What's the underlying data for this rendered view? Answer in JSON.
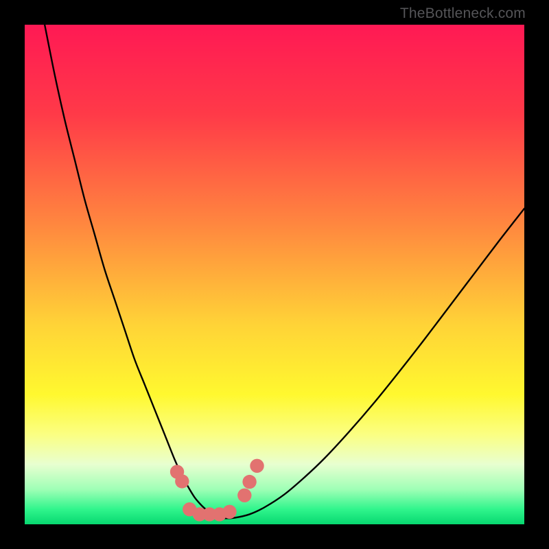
{
  "watermark": {
    "text": "TheBottleneck.com"
  },
  "chart_data": {
    "type": "line",
    "title": "",
    "xlabel": "",
    "ylabel": "",
    "xlim": [
      0,
      100
    ],
    "ylim": [
      0,
      100
    ],
    "gradient_stops": [
      {
        "offset": 0,
        "color": "#ff1954"
      },
      {
        "offset": 18,
        "color": "#ff3a48"
      },
      {
        "offset": 40,
        "color": "#ff873f"
      },
      {
        "offset": 60,
        "color": "#ffd337"
      },
      {
        "offset": 74,
        "color": "#fff82f"
      },
      {
        "offset": 82,
        "color": "#fbff82"
      },
      {
        "offset": 88,
        "color": "#e8ffd0"
      },
      {
        "offset": 93,
        "color": "#9fffb6"
      },
      {
        "offset": 97,
        "color": "#30f58c"
      },
      {
        "offset": 100,
        "color": "#07d870"
      }
    ],
    "series": [
      {
        "name": "bottleneck-curve",
        "x": [
          4,
          6,
          8,
          10,
          12,
          14,
          16,
          18,
          20,
          22,
          24,
          26,
          28,
          30,
          31,
          32,
          33,
          34,
          35,
          36,
          37,
          38,
          39,
          40,
          42,
          45,
          48,
          52,
          56,
          60,
          65,
          70,
          75,
          80,
          85,
          90,
          95,
          100
        ],
        "y": [
          100,
          90,
          81,
          73,
          65,
          58,
          51,
          45,
          39,
          33,
          28,
          23,
          18,
          13,
          10.8,
          8.8,
          7,
          5.4,
          4.2,
          3.2,
          2.4,
          1.8,
          1.4,
          1.2,
          1.3,
          2.0,
          3.4,
          6.0,
          9.4,
          13.2,
          18.6,
          24.4,
          30.6,
          37.0,
          43.6,
          50.2,
          56.8,
          63.2
        ]
      }
    ],
    "markers": {
      "name": "highlighted-points",
      "color": "#e27270",
      "radius_ratio": 0.014,
      "points": [
        {
          "x": 30.5,
          "y": 10.5
        },
        {
          "x": 31.5,
          "y": 8.6
        },
        {
          "x": 33.0,
          "y": 3.0
        },
        {
          "x": 35.0,
          "y": 2.0
        },
        {
          "x": 37.0,
          "y": 2.0
        },
        {
          "x": 39.0,
          "y": 2.0
        },
        {
          "x": 41.0,
          "y": 2.5
        },
        {
          "x": 44.0,
          "y": 5.8
        },
        {
          "x": 45.0,
          "y": 8.5
        },
        {
          "x": 46.5,
          "y": 11.7
        }
      ]
    }
  }
}
